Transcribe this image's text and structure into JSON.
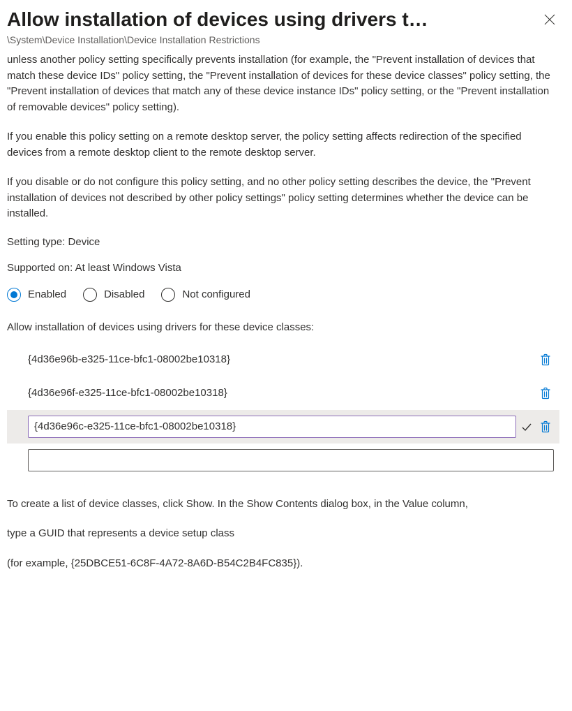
{
  "header": {
    "title": "Allow installation of devices using drivers t…",
    "breadcrumb": "\\System\\Device Installation\\Device Installation Restrictions"
  },
  "body": {
    "p1": "unless another policy setting specifically prevents installation (for example, the \"Prevent installation of devices that match these device IDs\" policy setting, the \"Prevent installation of devices for these device classes\" policy setting, the \"Prevent installation of devices that match any of these device instance IDs\" policy setting, or the \"Prevent installation of removable devices\" policy setting).",
    "p2": "If you enable this policy setting on a remote desktop server, the policy setting affects redirection of the specified devices from a remote desktop client to the remote desktop server.",
    "p3": "If you disable or do not configure this policy setting, and no other policy setting describes the device, the \"Prevent installation of devices not described by other policy settings\" policy setting determines whether the device can be installed."
  },
  "meta": {
    "setting_type": "Setting type: Device",
    "supported_on": "Supported on: At least Windows Vista"
  },
  "state": {
    "options": {
      "enabled": "Enabled",
      "disabled": "Disabled",
      "not_configured": "Not configured"
    },
    "selected": "enabled"
  },
  "device_classes": {
    "label": "Allow installation of devices using drivers for these device classes:",
    "items": [
      "{4d36e96b-e325-11ce-bfc1-08002be10318}",
      "{4d36e96f-e325-11ce-bfc1-08002be10318}"
    ],
    "editing_value": "{4d36e96c-e325-11ce-bfc1-08002be10318}",
    "new_value": ""
  },
  "footer": {
    "p1": "To create a list of device classes, click Show. In the Show Contents dialog box, in the Value column,",
    "p2": "type a GUID that represents a device setup class",
    "p3": "(for example, {25DBCE51-6C8F-4A72-8A6D-B54C2B4FC835})."
  }
}
